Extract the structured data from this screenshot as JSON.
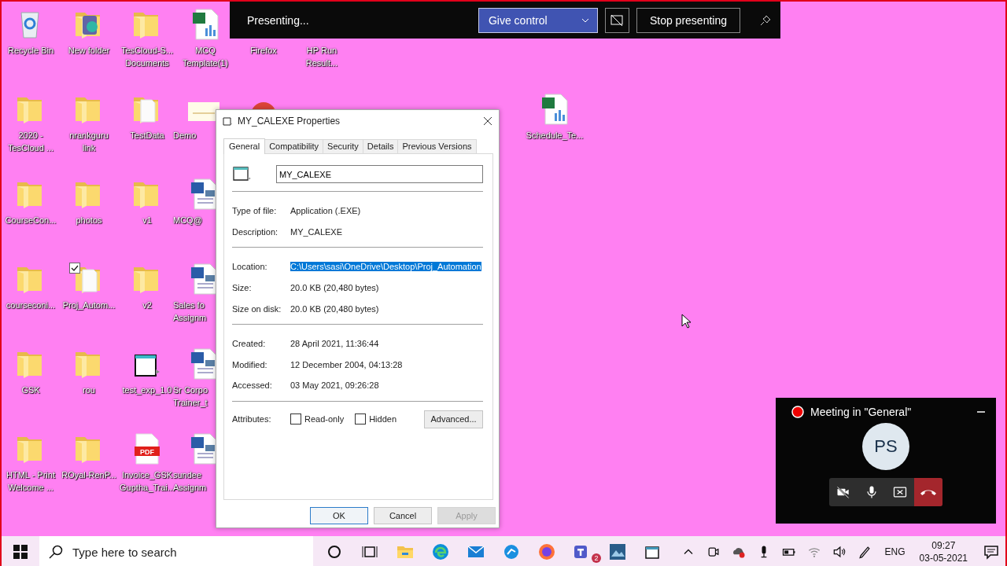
{
  "desktop": {
    "icons": [
      {
        "kind": "recycle-bin",
        "lines": [
          "Recycle Bin"
        ]
      },
      {
        "kind": "folder",
        "lines": [
          "2020 -",
          "TesCloud ..."
        ]
      },
      {
        "kind": "folder",
        "lines": [
          "CourseCon..."
        ]
      },
      {
        "kind": "folder",
        "lines": [
          "courseconi..."
        ]
      },
      {
        "kind": "folder",
        "lines": [
          "GSK"
        ]
      },
      {
        "kind": "folder",
        "lines": [
          "HTML - Print",
          "Welcome ..."
        ]
      },
      {
        "kind": "app-folder",
        "lines": [
          "New folder"
        ]
      },
      {
        "kind": "folder",
        "lines": [
          "nrankguru",
          "link"
        ]
      },
      {
        "kind": "folder",
        "lines": [
          "photos"
        ]
      },
      {
        "kind": "doc-folder",
        "lines": [
          "Proj_Autom..."
        ],
        "checked": true
      },
      {
        "kind": "folder",
        "lines": [
          "rou"
        ]
      },
      {
        "kind": "folder",
        "lines": [
          "ROyal-RenP..."
        ]
      },
      {
        "kind": "folder",
        "lines": [
          "TesCloud-S...",
          "Documents"
        ]
      },
      {
        "kind": "doc-folder",
        "lines": [
          "TestData"
        ]
      },
      {
        "kind": "folder",
        "lines": [
          "v1"
        ]
      },
      {
        "kind": "folder",
        "lines": [
          "v2"
        ]
      },
      {
        "kind": "program",
        "lines": [
          "test_exp_1.0"
        ]
      },
      {
        "kind": "pdf",
        "lines": [
          "Invoice_GSK",
          "Guptha_Trai..."
        ],
        "icon_text": "PDF"
      },
      {
        "kind": "spreadsheet",
        "lines": [
          "MCQ",
          "Template(1)"
        ]
      },
      {
        "kind": "image",
        "lines": [
          "Demo"
        ]
      },
      {
        "kind": "document",
        "lines": [
          "MCQ@"
        ]
      },
      {
        "kind": "document",
        "lines": [
          "Sales fo",
          "Assignm"
        ]
      },
      {
        "kind": "document",
        "lines": [
          "Sr Corpo",
          "Trainer_t"
        ]
      },
      {
        "kind": "document",
        "lines": [
          "sundee",
          "Assignm"
        ]
      },
      {
        "lines": [
          "Firefox"
        ]
      },
      {
        "kind": "chrome"
      },
      {
        "lines": [
          "HP Run",
          "Result..."
        ]
      },
      {
        "kind": "spreadsheet",
        "lines": [
          "Schedule_Te..."
        ]
      }
    ]
  },
  "presenting_bar": {
    "status": "Presenting...",
    "give_control": "Give control",
    "stop": "Stop presenting"
  },
  "dialog": {
    "title": "MY_CALEXE Properties",
    "tabs": [
      {
        "label": "General",
        "selected": true
      },
      {
        "label": "Compatibility",
        "selected": false
      },
      {
        "label": "Security",
        "selected": false
      },
      {
        "label": "Details",
        "selected": false
      },
      {
        "label": "Previous Versions",
        "selected": false
      }
    ],
    "name": "MY_CALEXE",
    "groups": [
      [
        {
          "label": "Type of file:",
          "value": "Application (.EXE)",
          "selected": false
        },
        {
          "label": "Description:",
          "value": "MY_CALEXE",
          "selected": false
        }
      ],
      [
        {
          "label": "Location:",
          "value": "C:\\Users\\sasi\\OneDrive\\Desktop\\Proj_Automation",
          "selected": true
        },
        {
          "label": "Size:",
          "value": "20.0 KB (20,480 bytes)",
          "selected": false
        },
        {
          "label": "Size on disk:",
          "value": "20.0 KB (20,480 bytes)",
          "selected": false
        }
      ],
      [
        {
          "label": "Created:",
          "value": "28 April 2021, 11:36:44",
          "selected": false
        },
        {
          "label": "Modified:",
          "value": "12 December 2004, 04:13:28",
          "selected": false
        },
        {
          "label": "Accessed:",
          "value": "03 May 2021, 09:26:28",
          "selected": false
        }
      ]
    ],
    "attributes": {
      "label": "Attributes:",
      "options": [
        {
          "label": "Read-only",
          "checked": false
        },
        {
          "label": "Hidden",
          "checked": false
        }
      ],
      "advanced": "Advanced..."
    },
    "buttons": [
      {
        "label": "OK",
        "default": true,
        "disabled": false
      },
      {
        "label": "Cancel",
        "default": false,
        "disabled": false
      },
      {
        "label": "Apply",
        "default": false,
        "disabled": true
      }
    ]
  },
  "meeting": {
    "title": "Meeting in \"General\"",
    "recording": true,
    "initials": "PS",
    "controls": [
      {
        "kind": "camera-off"
      },
      {
        "kind": "microphone"
      },
      {
        "kind": "stop-share"
      },
      {
        "kind": "hang-up"
      }
    ]
  },
  "taskbar": {
    "search": {
      "placeholder": "Type here to search"
    },
    "apps": [
      {
        "kind": "cortana"
      },
      {
        "kind": "task-view"
      },
      {
        "kind": "explorer"
      },
      {
        "kind": "edge"
      },
      {
        "kind": "mail"
      },
      {
        "kind": "network-app"
      },
      {
        "kind": "firefox"
      },
      {
        "kind": "teams",
        "badge": "2"
      },
      {
        "kind": "photo-app"
      },
      {
        "kind": "window"
      }
    ],
    "tray": [
      {
        "kind": "chevron"
      },
      {
        "kind": "meet-now"
      },
      {
        "kind": "cloud"
      },
      {
        "kind": "microphone"
      },
      {
        "kind": "battery"
      },
      {
        "kind": "wifi"
      },
      {
        "kind": "volume"
      },
      {
        "kind": "pen"
      }
    ],
    "language": "ENG",
    "time": "09:27",
    "date": "03-05-2021"
  }
}
